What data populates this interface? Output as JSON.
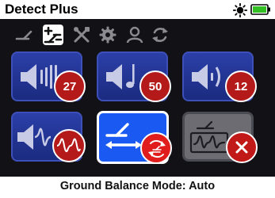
{
  "header": {
    "title": "Detect Plus",
    "icons": [
      "brightness-icon",
      "battery-icon"
    ],
    "battery_color": "#33c024"
  },
  "tabs": [
    {
      "icon": "detect-coil-icon",
      "active": false
    },
    {
      "icon": "detect-plus-icon",
      "active": true
    },
    {
      "icon": "tools-icon",
      "active": false
    },
    {
      "icon": "settings-gear-icon",
      "active": false
    },
    {
      "icon": "user-profile-icon",
      "active": false
    },
    {
      "icon": "reset-icon",
      "active": false
    }
  ],
  "tiles": [
    {
      "icon": "volume-level-icon",
      "value": "27"
    },
    {
      "icon": "threshold-tone-icon",
      "value": "50"
    },
    {
      "icon": "target-volume-icon",
      "value": "12"
    },
    {
      "icon": "threshold-audio-icon",
      "badge_icon": "tone-wave-icon"
    },
    {
      "icon": "ground-balance-icon",
      "badge_icon": "auto-tracking-icon",
      "active": true
    },
    {
      "icon": "ground-balance-noise-icon",
      "badge_icon": "off-x-icon",
      "disabled": true
    }
  ],
  "status": {
    "text": "Ground Balance Mode: Auto"
  },
  "colors": {
    "tile_blue": "#2b3fa8",
    "tile_active": "#1a5af2",
    "badge_red": "#b51a1a",
    "background": "#121216"
  }
}
